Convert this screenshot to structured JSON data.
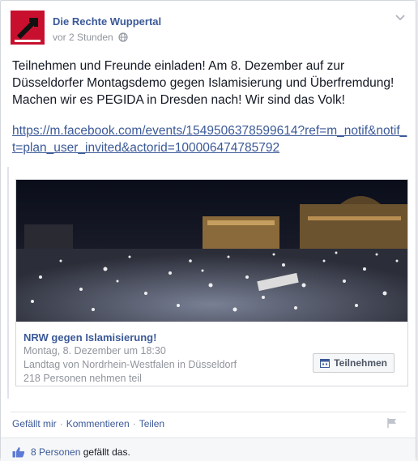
{
  "post": {
    "author": "Die Rechte Wuppertal",
    "timestamp": "vor 2 Stunden",
    "text": "Teilnehmen und Freunde einladen! Am 8. Dezember auf zur Düsseldorfer Montagsdemo gegen Islamisierung und Überfremdung! Machen wir es PEGIDA in Dresden nach! Wir sind das Volk!",
    "link": "https://m.facebook.com/events/1549506378599614?ref=m_notif&notif_t=plan_user_invited&actorid=100006474785792"
  },
  "event": {
    "title": "NRW gegen Islamisierung!",
    "date": "Montag, 8. Dezember um 18:30",
    "location": "Landtag von Nordrhein-Westfalen in Düsseldorf",
    "attendees": "218 Personen nehmen teil",
    "join_label": "Teilnehmen"
  },
  "actions": {
    "like": "Gefällt mir",
    "comment": "Kommentieren",
    "share": "Teilen",
    "separator": "·"
  },
  "likes": {
    "count": "8 Personen",
    "suffix": "gefällt das."
  },
  "icons": [
    "globe-icon",
    "chevron-down-icon",
    "calendar-icon",
    "flag-icon",
    "thumbs-up-icon"
  ],
  "colors": {
    "link": "#3b5998",
    "avatar_red": "#c8102e"
  }
}
